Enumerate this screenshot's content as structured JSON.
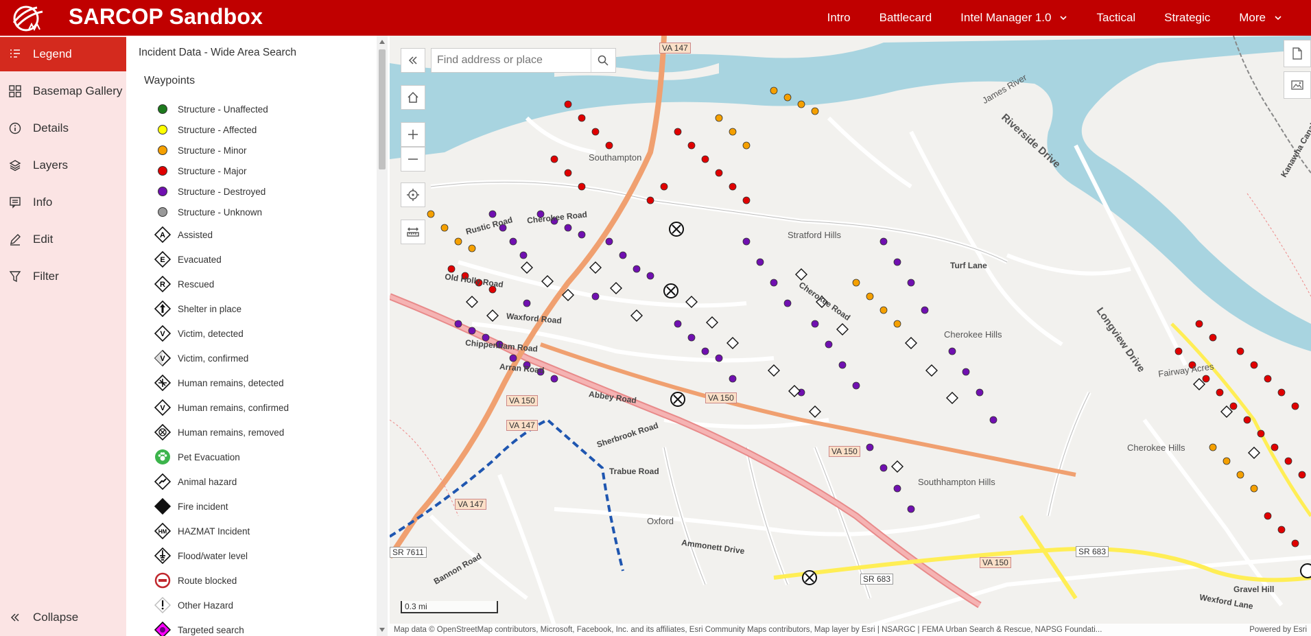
{
  "header": {
    "title": "SARCOP Sandbox",
    "nav": [
      {
        "label": "Intro"
      },
      {
        "label": "Battlecard"
      },
      {
        "label": "Intel Manager 1.0",
        "dropdown": true
      },
      {
        "label": "Tactical"
      },
      {
        "label": "Strategic"
      },
      {
        "label": "More",
        "dropdown": true
      }
    ],
    "bg_color": "#c00000"
  },
  "sidebar": {
    "items": [
      {
        "label": "Legend",
        "icon": "legend-icon",
        "active": true
      },
      {
        "label": "Basemap Gallery",
        "icon": "basemap-gallery-icon"
      },
      {
        "label": "Details",
        "icon": "info-circle-icon"
      },
      {
        "label": "Layers",
        "icon": "layers-icon"
      },
      {
        "label": "Info",
        "icon": "popup-icon"
      },
      {
        "label": "Edit",
        "icon": "edit-icon"
      },
      {
        "label": "Filter",
        "icon": "filter-icon"
      }
    ],
    "collapse_label": "Collapse",
    "active_color": "#d42a1e",
    "bg_color": "#fbe4e4"
  },
  "legend": {
    "panel_title": "Incident Data - Wide Area Search",
    "layer_title": "Waypoints",
    "items": [
      {
        "label": "Structure - Unaffected",
        "symbol": "circle",
        "color": "#1d7a1d"
      },
      {
        "label": "Structure - Affected",
        "symbol": "circle",
        "color": "#ffff00"
      },
      {
        "label": "Structure - Minor",
        "symbol": "circle",
        "color": "#f5a000"
      },
      {
        "label": "Structure - Major",
        "symbol": "circle",
        "color": "#e00000"
      },
      {
        "label": "Structure - Destroyed",
        "symbol": "circle",
        "color": "#7010b0"
      },
      {
        "label": "Structure - Unknown",
        "symbol": "circle",
        "color": "#999999"
      },
      {
        "label": "Assisted",
        "symbol": "diamond-letter",
        "letter": "A"
      },
      {
        "label": "Evacuated",
        "symbol": "diamond-letter",
        "letter": "E"
      },
      {
        "label": "Rescued",
        "symbol": "diamond-letter",
        "letter": "R"
      },
      {
        "label": "Shelter in place",
        "symbol": "diamond-arrow"
      },
      {
        "label": "Victim, detected",
        "symbol": "diamond-letter",
        "letter": "V"
      },
      {
        "label": "Victim, confirmed",
        "symbol": "diamond-letter-filled",
        "letter": "V"
      },
      {
        "label": "Human remains, detected",
        "symbol": "diamond-cross"
      },
      {
        "label": "Human remains, confirmed",
        "symbol": "diamond-letter",
        "letter": "V"
      },
      {
        "label": "Human remains, removed",
        "symbol": "diamond-cross-circle"
      },
      {
        "label": "Pet Evacuation",
        "symbol": "paw-circle"
      },
      {
        "label": "Animal hazard",
        "symbol": "diamond-animal"
      },
      {
        "label": "Fire incident",
        "symbol": "diamond-filled"
      },
      {
        "label": "HAZMAT Incident",
        "symbol": "diamond-letter",
        "letter": "HM"
      },
      {
        "label": "Flood/water level",
        "symbol": "diamond-water"
      },
      {
        "label": "Route blocked",
        "symbol": "circle-blocked"
      },
      {
        "label": "Other Hazard",
        "symbol": "diamond-exclaim"
      },
      {
        "label": "Targeted search",
        "symbol": "diamond-magenta"
      }
    ]
  },
  "map": {
    "search_placeholder": "Find address or place",
    "scale_label": "0.3 mi",
    "attribution": "Map data © OpenStreetMap contributors, Microsoft, Facebook, Inc. and its affiliates, Esri Community Maps contributors, Map layer by Esri | NSARGC | FEMA Urban Search & Rescue, NAPSG Foundati...",
    "powered_by": "Powered by Esri",
    "labels": {
      "cherokee_road": "Cherokee Road",
      "riverside_drive": "Riverside Drive",
      "james_river": "James River",
      "southampton": "Southampton",
      "stratford_hills": "Stratford Hills",
      "cherokee_hills": "Cherokee Hills",
      "cherokee_hills_2": "Cherokee Hills",
      "southhampton_hills": "Southhampton Hills",
      "fairway_acres": "Fairway Acres",
      "oxford": "Oxford",
      "abbey_road": "Abbey Road",
      "trabue_road": "Trabue Road",
      "sherbrook_road": "Sherbrook Road",
      "ammonett_drive": "Ammonett Drive",
      "bannon_road": "Bannon Road",
      "turf_lane": "Turf Lane",
      "longview_drive": "Longview Drive",
      "waxford_road": "Waxford Road",
      "chippenham_road": "Chippenham Road",
      "arran_road": "Arran Road",
      "old_holly_road": "Old Holly Road",
      "rustic_road": "Rustic Road",
      "wexford_lane": "Wexford Lane",
      "gravel_hill": "Gravel Hill",
      "kanawha_canal": "Kanawha Canal"
    },
    "shields": {
      "va147_top": "VA 147",
      "va147_mid": "VA 147",
      "va147_low": "VA 147",
      "va150_a": "VA 150",
      "va150_b": "VA 150",
      "va150_c": "VA 150",
      "va150_d": "VA 150",
      "sr683_a": "SR 683",
      "sr683_b": "SR 683",
      "sr7611": "SR 7611"
    },
    "colors": {
      "water": "#a8d4e0",
      "major_road": "#f0a070",
      "highway": "#e88a8a",
      "yellow_road": "#ffee55",
      "destroyed": "#7010b0",
      "major": "#e00000",
      "minor": "#f5a000"
    }
  }
}
